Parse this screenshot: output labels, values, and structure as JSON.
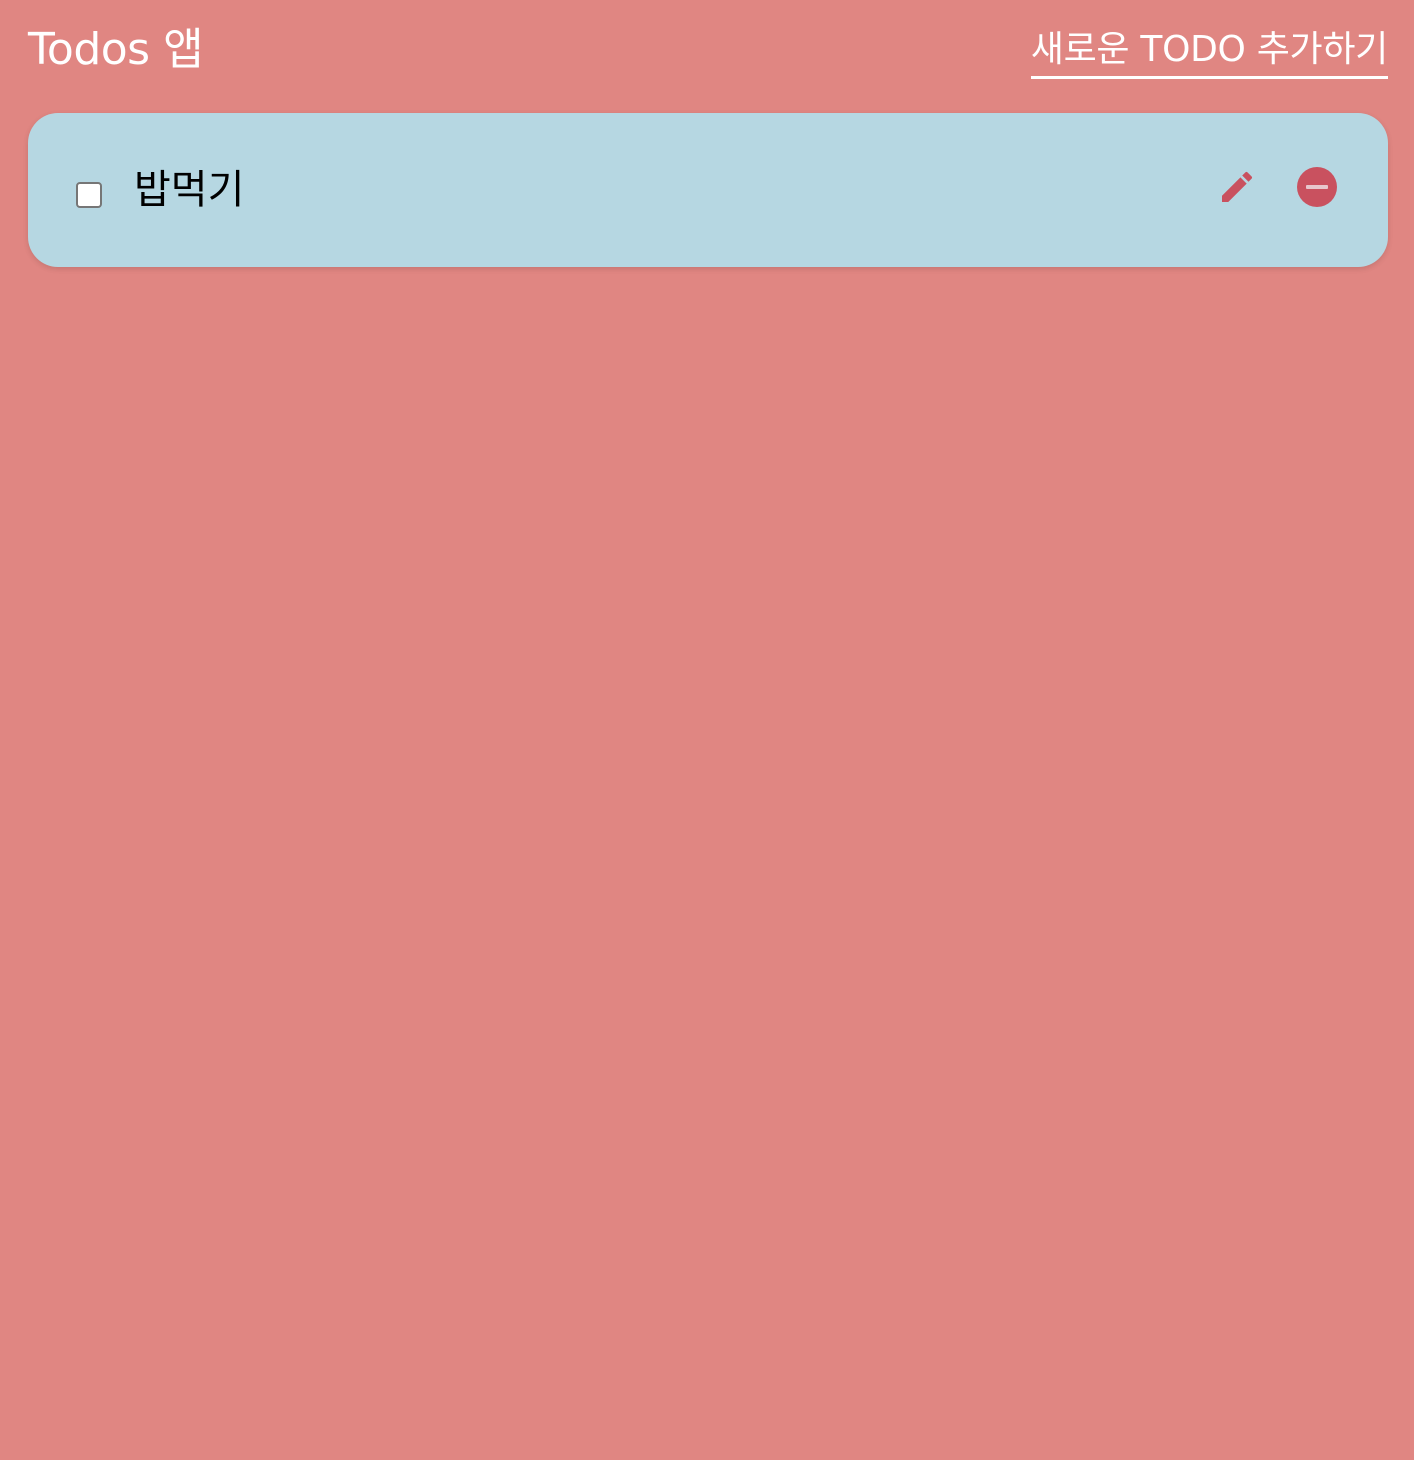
{
  "header": {
    "title": "Todos 앱",
    "add_link_label": "새로운 TODO 추가하기"
  },
  "todos": [
    {
      "text": "밥먹기",
      "completed": false,
      "edit_icon": "pencil-icon",
      "delete_icon": "minus-circle-icon"
    }
  ],
  "colors": {
    "background": "#e08682",
    "card": "#b6d7e2",
    "icon_accent": "#c9515f",
    "header_text": "#ffffff"
  }
}
